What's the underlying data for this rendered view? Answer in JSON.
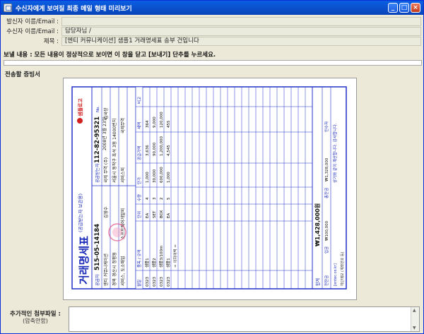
{
  "window": {
    "title": "수신자에게 보여질 최종 메일 형태 미리보기",
    "accent": "#0a5ee3",
    "buttons": [
      "minimize",
      "maximize",
      "close"
    ]
  },
  "header": {
    "sender_label": "발신자 이름/Email :",
    "sender_value": "",
    "recipient_label": "수신자 이름/Email :",
    "recipient_value": "담당자님 /",
    "subject_label": "제목 :",
    "subject_value": "[엔티 커뮤니케이션] 샘플1 거래명세표 송부 건입니다"
  },
  "notice": "보낼 내용 : 모든 내용이 정상적으로 보이면 이 창을 닫고 [보내기] 단추를 누르세요.",
  "section_label": "전송할 증빙서",
  "invoice": {
    "brand": "샘플로고",
    "title": "거래명세표",
    "subtitle": "(공급받는자 보관용)",
    "no_label": "No.",
    "date": "2008년 3월 23일",
    "supplier_label": "공급자",
    "buyer_label": "공급받는자",
    "supplier_reg_no": "515-05-14184",
    "supplier_name": "엔티 커뮤니케이션",
    "supplier_rep": "김영수",
    "supplier_address": "경북 경산시 정평동",
    "supplier_business": "서비스, 도소매업",
    "supplier_item": "소프트웨어개발외",
    "buyer_reg_no": "112-82-95321",
    "buyer_name": "국제 무역 (주)",
    "buyer_rep": "김국장",
    "buyer_address": "서울시 동작구 흑석 3동 14000번지",
    "buyer_business": "서비스외",
    "buyer_item": "국제무역",
    "buyer_email": "",
    "seal": "(인)",
    "labels": {
      "reg_no": "등록번호",
      "name": "상호",
      "rep": "성명",
      "address": "주소",
      "business": "업태",
      "item": "종목"
    },
    "amount_label": "합계금액",
    "amount_korean": "",
    "columns": [
      "월일",
      "품목 / 규격",
      "단위",
      "수량",
      "단가",
      "공급가액",
      "세액",
      "비고"
    ],
    "rows": [
      {
        "date": "0323",
        "item": "샘플1",
        "unit": "EA",
        "qty": "4",
        "price": "1,000",
        "supply": "3,636",
        "tax": "364",
        "note": ""
      },
      {
        "date": "0323",
        "item": "샘플2",
        "unit": "SET",
        "qty": "3",
        "price": "30,000",
        "supply": "90,000",
        "tax": "9,000",
        "note": ""
      },
      {
        "date": "0323",
        "item": "샘플3/100m",
        "unit": "BOX",
        "qty": "2",
        "price": "600,000",
        "supply": "1,200,000",
        "tax": "120,000",
        "note": ""
      },
      {
        "date": "0323",
        "item": "샘플1",
        "unit": "EA",
        "qty": "5",
        "price": "1,000",
        "supply": "4,545",
        "tax": "455",
        "note": ""
      }
    ],
    "footer_note": "= 이하여백 =",
    "total_label": "합계",
    "total": "₩1,428,000원",
    "prev_balance_label": "전잔금",
    "deposit_label": "입금",
    "deposit": "₩100,000",
    "outstanding_label": "총잔금",
    "outstanding": "₩1,328,000",
    "receiver_label": "인수자",
    "thanks": "상기와 같이 계산합니다. 감사합니다.",
    "site": "[entec.co.kr]",
    "small_note": "하단메모 (계좌번호 등)"
  },
  "attachment": {
    "label": "추가적인 첨부파일 :",
    "sub": "(압축안함)"
  }
}
